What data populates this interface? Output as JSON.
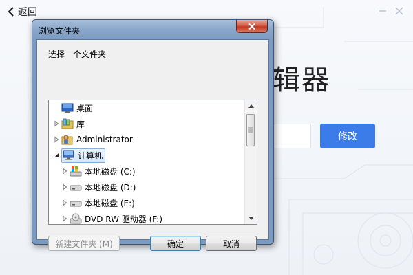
{
  "app": {
    "back_label": "返回",
    "title_visible": "辑器",
    "modify_label": "修改",
    "accent": "#3b7ce8"
  },
  "dialog": {
    "title": "浏览文件夹",
    "prompt": "选择一个文件夹",
    "close_icon": "close-icon",
    "tree": [
      {
        "label": "桌面",
        "icon": "desktop-icon",
        "expander": "none",
        "level": 0,
        "selected": false
      },
      {
        "label": "库",
        "icon": "library-icon",
        "expander": "collapsed",
        "level": 0,
        "selected": false
      },
      {
        "label": "Administrator",
        "icon": "user-folder-icon",
        "expander": "collapsed",
        "level": 0,
        "selected": false
      },
      {
        "label": "计算机",
        "icon": "computer-icon",
        "expander": "expanded",
        "level": 0,
        "selected": true
      },
      {
        "label": "本地磁盘 (C:)",
        "icon": "system-drive-icon",
        "expander": "collapsed",
        "level": 1,
        "selected": false
      },
      {
        "label": "本地磁盘 (D:)",
        "icon": "drive-icon",
        "expander": "collapsed",
        "level": 1,
        "selected": false
      },
      {
        "label": "本地磁盘 (E:)",
        "icon": "drive-icon",
        "expander": "collapsed",
        "level": 1,
        "selected": false
      },
      {
        "label": "DVD RW 驱动器 (F:)",
        "icon": "dvd-drive-icon",
        "expander": "collapsed",
        "level": 1,
        "selected": false
      }
    ],
    "buttons": {
      "new_folder": "新建文件夹 (M)",
      "ok": "确定",
      "cancel": "取消"
    }
  }
}
